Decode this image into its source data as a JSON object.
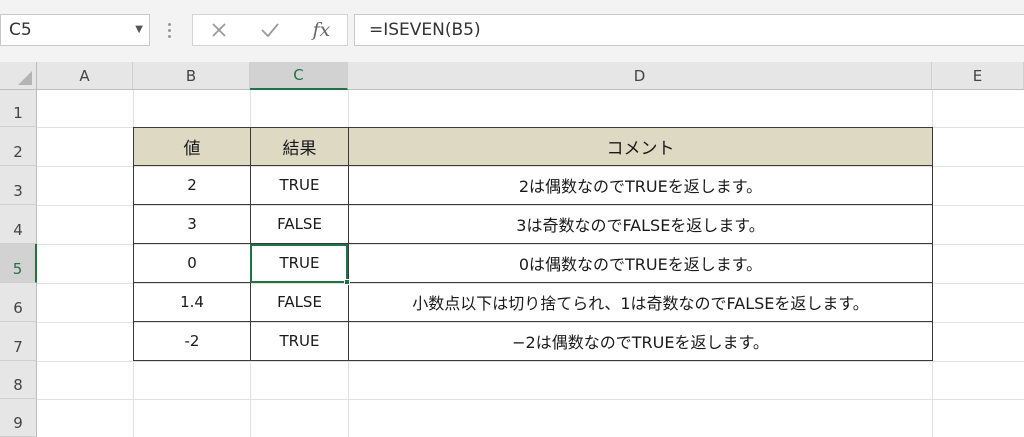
{
  "name_box": {
    "value": "C5"
  },
  "formula_buttons": {
    "cancel_icon": "close-icon",
    "enter_icon": "check-icon",
    "fx_label": "fx"
  },
  "formula_bar": {
    "value": "=ISEVEN(B5)"
  },
  "columns": [
    "A",
    "B",
    "C",
    "D",
    "E"
  ],
  "rows": [
    "1",
    "2",
    "3",
    "4",
    "5",
    "6",
    "7",
    "8",
    "9"
  ],
  "selected_cell": {
    "column": "C",
    "row": "5"
  },
  "table": {
    "headers": [
      "値",
      "結果",
      "コメント"
    ],
    "rows": [
      [
        "2",
        "TRUE",
        "2は偶数なのでTRUEを返します。"
      ],
      [
        "3",
        "FALSE",
        "3は奇数なのでFALSEを返します。"
      ],
      [
        "0",
        "TRUE",
        "0は偶数なのでTRUEを返します。"
      ],
      [
        "1.4",
        "FALSE",
        "小数点以下は切り捨てられ、1は奇数なのでFALSEを返します。"
      ],
      [
        "-2",
        "TRUE",
        "−2は偶数なのでTRUEを返します。"
      ]
    ]
  },
  "colors": {
    "accent": "#217346",
    "header_fill": "#ddd9c3",
    "header_bar": "#e6e6e6"
  }
}
